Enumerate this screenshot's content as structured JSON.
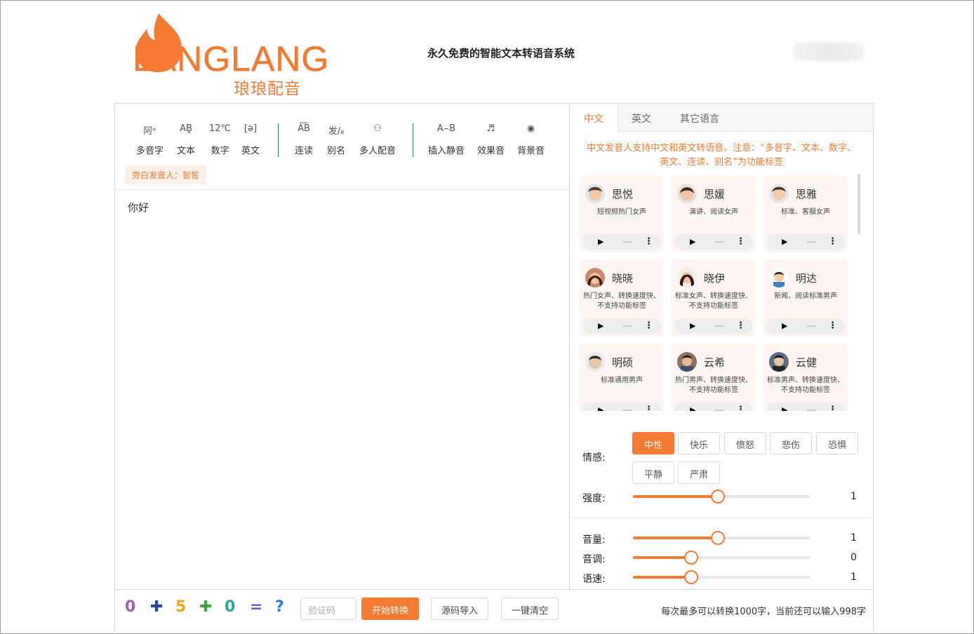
{
  "brand": {
    "logo_text": "LANGLANG",
    "logo_sub": "琅琅配音",
    "slogan": "永久免费的智能文本转语音系统"
  },
  "toolbar": {
    "tools": [
      {
        "icon": "阿ᵉ",
        "label": "多音字"
      },
      {
        "icon": "AB̥",
        "label": "文本"
      },
      {
        "icon": "12℃",
        "label": "数字"
      },
      {
        "icon": "[ə]",
        "label": "英文"
      },
      {
        "icon": "A͞B",
        "label": "连读"
      },
      {
        "icon": "发/₈",
        "label": "别名"
      },
      {
        "icon": "⚇",
        "label": "多人配音"
      },
      {
        "icon": "A⌢B",
        "label": "插入静音"
      },
      {
        "icon": "♬",
        "label": "效果音"
      },
      {
        "icon": "◉",
        "label": "背景音"
      }
    ],
    "narrator": "旁白发音人：智皙"
  },
  "editor": {
    "text": "你好"
  },
  "bottom": {
    "captcha_placeholder": "验证码",
    "convert_label": "开始转换",
    "import_label": "源码导入",
    "clear_label": "一键清空",
    "counter": "每次最多可以转换1000字，当前还可以输入998字"
  },
  "tabs": [
    "中文",
    "英文",
    "其它语言"
  ],
  "notice": "中文发音人支持中文和英文转语音。注意：“多音字、文本、数字、英文、连读、别名”为功能标签",
  "voices": [
    {
      "name": "思悦",
      "desc": "短视频热门女声",
      "color": "#f2c9a6"
    },
    {
      "name": "思媛",
      "desc": "演讲、阅读女声",
      "color": "#f0c4a4"
    },
    {
      "name": "思雅",
      "desc": "标准、客服女声",
      "color": "#f3ccaa"
    },
    {
      "name": "晓晓",
      "desc": "热门女声、转换速度快、不支持功能标签",
      "color": "#b86b4b"
    },
    {
      "name": "晓伊",
      "desc": "标准女声、转换速度快、不支持功能标签",
      "color": "#8a4a3a"
    },
    {
      "name": "明达",
      "desc": "新闻、阅读标准男声",
      "color": "#6fa6d8"
    },
    {
      "name": "明硕",
      "desc": "标准通用男声",
      "color": "#e8c7a8"
    },
    {
      "name": "云希",
      "desc": "热门男声、转换速度快、不支持功能标签",
      "color": "#7c5e48"
    },
    {
      "name": "云健",
      "desc": "标准男声、转换速度快、不支持功能标签",
      "color": "#5a6b82"
    }
  ],
  "settings": {
    "emotion_label": "情感:",
    "emotions": [
      "中性",
      "快乐",
      "愤怒",
      "悲伤",
      "恐惧",
      "平静",
      "严肃"
    ],
    "selected_emotion": "中性",
    "intensity": {
      "label": "强度:",
      "value": "1",
      "fraction": 0.48
    },
    "volume": {
      "label": "音量:",
      "value": "1",
      "fraction": 0.48
    },
    "pitch": {
      "label": "音调:",
      "value": "0",
      "fraction": 0.33
    },
    "speed": {
      "label": "语速:",
      "value": "1",
      "fraction": 0.33
    }
  },
  "colors": {
    "accent": "#f47a32"
  }
}
